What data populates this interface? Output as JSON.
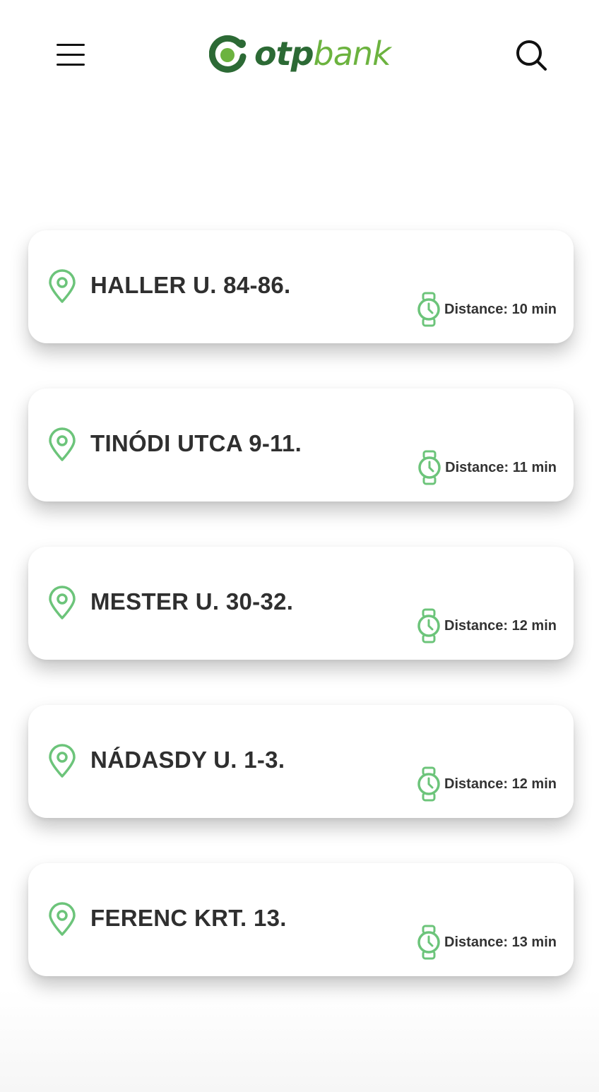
{
  "header": {
    "menu_icon": "hamburger-menu-icon",
    "logo": {
      "mark": "otp-logo-mark",
      "text_primary": "otp",
      "text_secondary": "bank",
      "color_primary": "#2c6a35",
      "color_secondary": "#6cb33f"
    },
    "search_icon": "search-icon"
  },
  "colors": {
    "accent_green": "#6cc47a",
    "text_dark": "#2f2f2f"
  },
  "branches": [
    {
      "name": "HALLER U. 84-86.",
      "distance": "Distance: 10 min"
    },
    {
      "name": "TINÓDI UTCA 9-11.",
      "distance": "Distance: 11 min"
    },
    {
      "name": "MESTER U. 30-32.",
      "distance": "Distance: 12 min"
    },
    {
      "name": "NÁDASDY U. 1-3.",
      "distance": "Distance: 12 min"
    },
    {
      "name": "FERENC KRT. 13.",
      "distance": "Distance: 13 min"
    }
  ]
}
